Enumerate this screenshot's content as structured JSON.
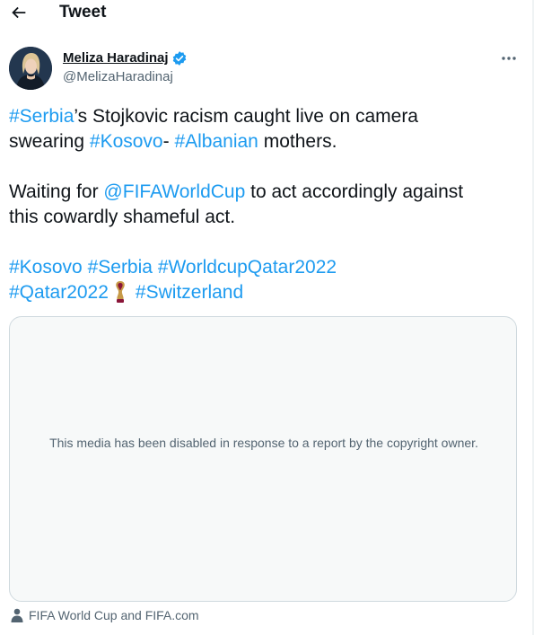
{
  "header": {
    "back_icon": "arrow-left-icon",
    "title": "Tweet"
  },
  "author": {
    "name": "Meliza Haradinaj",
    "handle": "@MelizaHaradinaj",
    "verified_icon": "verified-badge-icon",
    "more_icon": "more-dots-icon"
  },
  "tweet": {
    "line1": {
      "t1": "#Serbia",
      "t2": "’s Stojkovic racism caught live on camera"
    },
    "line2": {
      "t1": "swearing ",
      "t2": "#Kosovo",
      "t3": "- ",
      "t4": "#Albanian",
      "t5": " mothers."
    },
    "line3": {
      "t1": "Waiting for ",
      "t2": "@FIFAWorldCup",
      "t3": " to act accordingly against"
    },
    "line4": {
      "t1": "this cowardly shameful act."
    },
    "line5": {
      "t1": "#Kosovo",
      "t2": "#Serbia",
      "t3": "#WorldcupQatar2022"
    },
    "line6": {
      "t1": "#Qatar2022",
      "trophy_icon": "world-cup-trophy-icon",
      "t2": "#Switzerland"
    }
  },
  "media": {
    "notice": "This media has been disabled in response to a report by the copyright owner."
  },
  "credit": {
    "icon": "person-icon",
    "text": "FIFA World Cup and FIFA.com"
  },
  "colors": {
    "link": "#1d9bf0",
    "text": "#0f1419",
    "secondary": "#536471",
    "media_bg": "#f7f9f9",
    "border": "#cfd9de"
  }
}
